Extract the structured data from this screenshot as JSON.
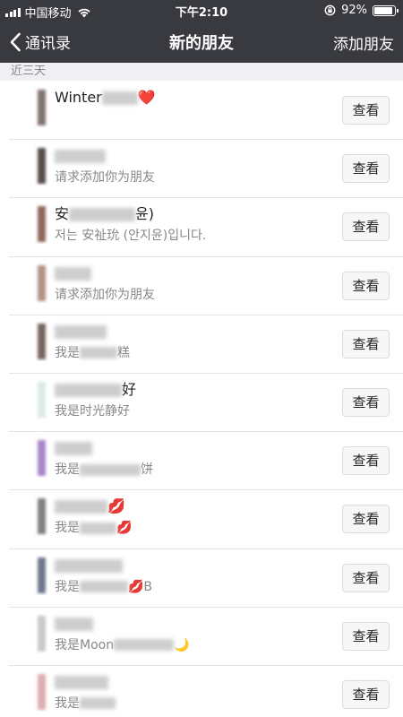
{
  "status_bar": {
    "carrier": "中国移动",
    "time": "下午2:10",
    "battery": "92%",
    "battery_level": 0.92
  },
  "nav": {
    "back_label": "通讯录",
    "title": "新的朋友",
    "action_label": "添加朋友"
  },
  "section": {
    "header": "近三天"
  },
  "view_label": "查看",
  "friends": [
    {
      "name": "Winter",
      "name_suffix": "❤️",
      "message": "",
      "avatar_color": "#6b5a55"
    },
    {
      "name": "",
      "name_suffix": "",
      "message": "请求添加你为朋友",
      "avatar_color": "#3a2f2c"
    },
    {
      "name": "安",
      "name_suffix": "윤)",
      "message": "저는 安祉玧 (안지윤)입니다.",
      "avatar_color": "#7a4d3f"
    },
    {
      "name": "",
      "name_suffix": "",
      "message": "请求添加你为朋友",
      "avatar_color": "#a67f6e"
    },
    {
      "name": "",
      "name_suffix": "",
      "message": "我是",
      "message_suffix": "糕",
      "avatar_color": "#5e4a45"
    },
    {
      "name": "",
      "name_suffix": "好",
      "message": "我是时光静好",
      "avatar_color": "#d4e6e3"
    },
    {
      "name": "",
      "name_suffix": "",
      "message": "我是",
      "message_suffix": "饼",
      "avatar_color": "#9b6fc1"
    },
    {
      "name": "",
      "name_suffix": "💋",
      "message": "我是",
      "message_suffix": "💋",
      "avatar_color": "#6a6a6a"
    },
    {
      "name": "",
      "name_suffix": "",
      "message": "我是",
      "message_suffix": "💋B",
      "avatar_color": "#55607a"
    },
    {
      "name": "",
      "name_suffix": "",
      "message": "我是Moon",
      "message_suffix": "🌙",
      "avatar_color": "#c0c0c0"
    },
    {
      "name": "",
      "name_suffix": "",
      "message": "我是",
      "message_suffix": "",
      "avatar_color": "#d8a0a5"
    }
  ]
}
